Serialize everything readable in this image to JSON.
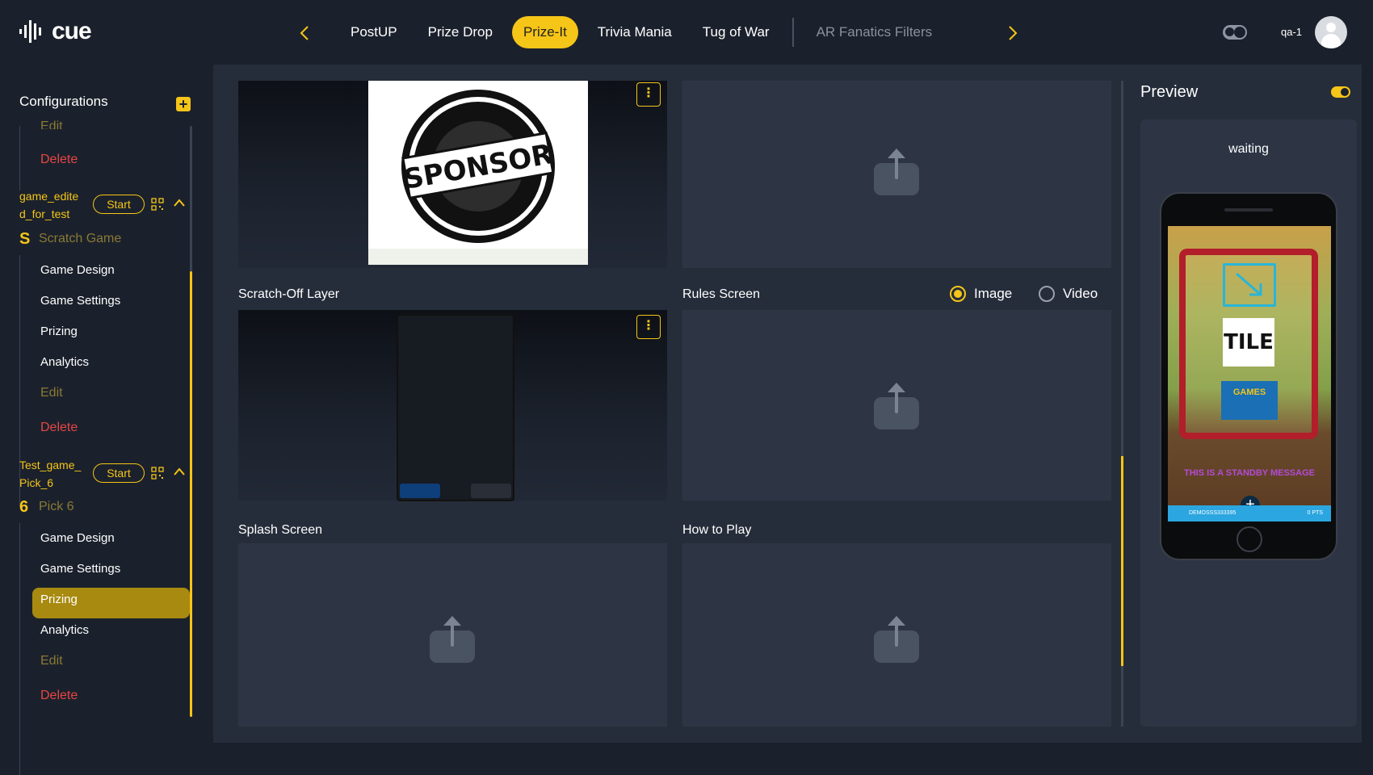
{
  "app": {
    "logo_text": "cue"
  },
  "nav": {
    "tabs": [
      {
        "label": "PostUP"
      },
      {
        "label": "Prize Drop"
      },
      {
        "label": "Prize-It"
      },
      {
        "label": "Trivia Mania"
      },
      {
        "label": "Tug of War"
      },
      {
        "label": "AR Fanatics Filters"
      }
    ],
    "active_tab": "Prize-It"
  },
  "user": {
    "name": "qa-1"
  },
  "sidebar": {
    "title": "Configurations",
    "top_items": {
      "edit": "Edit",
      "delete": "Delete"
    },
    "games": [
      {
        "name": "game_edited_for_test",
        "name_line1": "game_edite",
        "name_line2": "d_for_test",
        "start_label": "Start",
        "type_label": "Scratch Game",
        "items": [
          "Game Design",
          "Game Settings",
          "Prizing",
          "Analytics"
        ],
        "edit": "Edit",
        "delete": "Delete"
      },
      {
        "name": "Test_game_Pick_6",
        "name_line1": "Test_game_",
        "name_line2": "Pick_6",
        "start_label": "Start",
        "type_label": "Pick 6",
        "items": [
          "Game Design",
          "Game Settings",
          "Prizing",
          "Analytics"
        ],
        "edit": "Edit",
        "delete": "Delete",
        "active_item": "Game Design"
      }
    ]
  },
  "main": {
    "sections": {
      "scratch_off": "Scratch-Off Layer",
      "rules": "Rules Screen",
      "splash": "Splash Screen",
      "how_to_play": "How to Play"
    },
    "media_options": {
      "image": "Image",
      "video": "Video",
      "selected": "Image"
    },
    "sponsor_text": "SPONSOR"
  },
  "preview": {
    "title": "Preview",
    "status": "waiting",
    "tile_text": "TILE",
    "games_text": "GAMES",
    "message": "THIS IS A STANDBY MESSAGE",
    "user_tag": "DEMOSSS333395",
    "points": "0 PTS"
  },
  "colors": {
    "accent": "#f5c518",
    "danger": "#e84545",
    "bg": "#1b212c",
    "panel": "#2d3545"
  }
}
